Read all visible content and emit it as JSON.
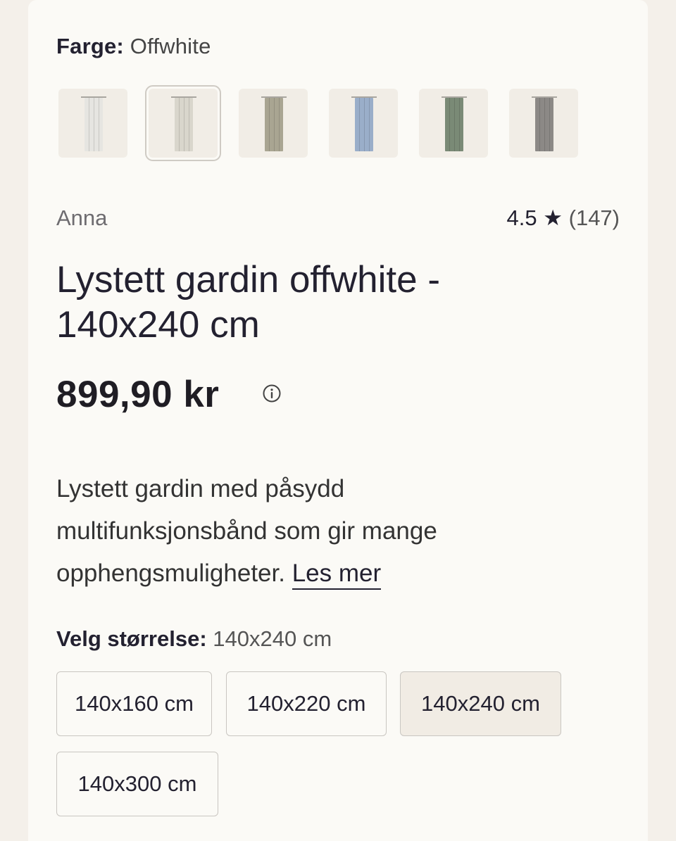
{
  "color": {
    "label": "Farge:",
    "value": "Offwhite",
    "swatches": [
      {
        "name": "white",
        "color": "#e6e5e1",
        "selected": false
      },
      {
        "name": "offwhite",
        "color": "#d9d6cc",
        "selected": true
      },
      {
        "name": "sand",
        "color": "#a9a592",
        "selected": false
      },
      {
        "name": "blue",
        "color": "#9aaec9",
        "selected": false
      },
      {
        "name": "green",
        "color": "#7a8a76",
        "selected": false
      },
      {
        "name": "grey",
        "color": "#8c8986",
        "selected": false
      }
    ]
  },
  "product": {
    "brand": "Anna",
    "rating": "4.5",
    "rating_icon": "star-icon",
    "rating_count": "(147)",
    "title": "Lystett gardin offwhite - 140x240 cm",
    "price": "899,90 kr",
    "price_info_icon": "info-icon",
    "description": "Lystett gardin med påsydd multifunksjonsbånd som gir mange opphengsmuligheter.",
    "read_more": "Les mer"
  },
  "size": {
    "label": "Velg størrelse:",
    "value": "140x240 cm",
    "options": [
      {
        "label": "140x160 cm",
        "selected": false
      },
      {
        "label": "140x220 cm",
        "selected": false
      },
      {
        "label": "140x240 cm",
        "selected": true
      },
      {
        "label": "140x300 cm",
        "selected": false
      }
    ]
  }
}
